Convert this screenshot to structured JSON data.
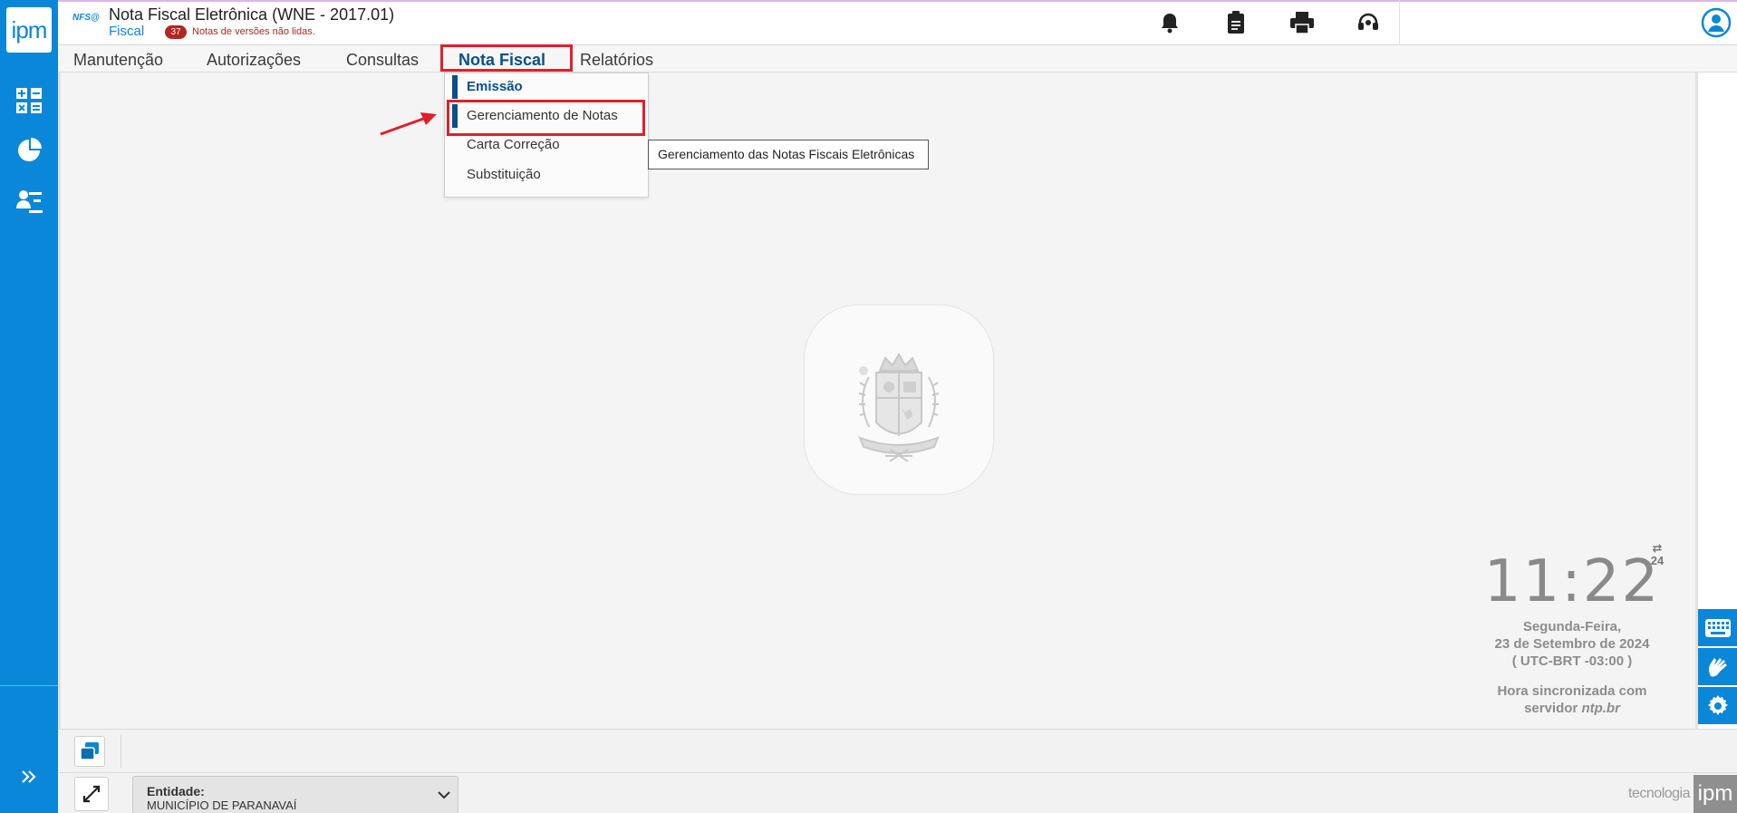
{
  "header": {
    "nfs_logo": "NFS",
    "title": "Nota Fiscal Eletrônica (WNE - 2017.01)",
    "subtitle": "Fiscal",
    "badge_count": "37",
    "badge_text": "Notas de versões não lidas.",
    "icons": [
      "bell-icon",
      "clipboard-icon",
      "printer-icon",
      "headset-icon",
      "user-circle-icon"
    ]
  },
  "sidebar": {
    "logo_text": "ipm",
    "icons": [
      "calculator-icon",
      "pie-chart-icon",
      "user-desk-icon",
      "double-chevron-right-icon"
    ]
  },
  "menu": {
    "items": [
      "Manutenção",
      "Autorizações",
      "Consultas",
      "Nota Fiscal",
      "Relatórios"
    ],
    "active": "Nota Fiscal"
  },
  "dropdown": {
    "items": [
      "Emissão",
      "Gerenciamento de Notas",
      "Carta Correção",
      "Substituição"
    ]
  },
  "tooltip": "Gerenciamento das Notas Fiscais Eletrônicas",
  "clock": {
    "time": "11:22",
    "format_label": "24",
    "day": "Segunda-Feira,",
    "date": "23 de Setembro de 2024",
    "timezone": "( UTC-BRT -03:00 )",
    "sync_text": "Hora sincronizada com",
    "sync_prefix": "servidor ",
    "sync_server": "ntp.br"
  },
  "footer": {
    "entity_label": "Entidade:",
    "entity_value": "MUNICÍPIO DE PARANAVAÍ",
    "brand_text": "tecnologia",
    "brand_logo": "ipm"
  },
  "colors": {
    "primary": "#0a87d8",
    "active_menu": "#0b4f8a",
    "highlight": "#e0202a",
    "badge": "#b3261e"
  }
}
